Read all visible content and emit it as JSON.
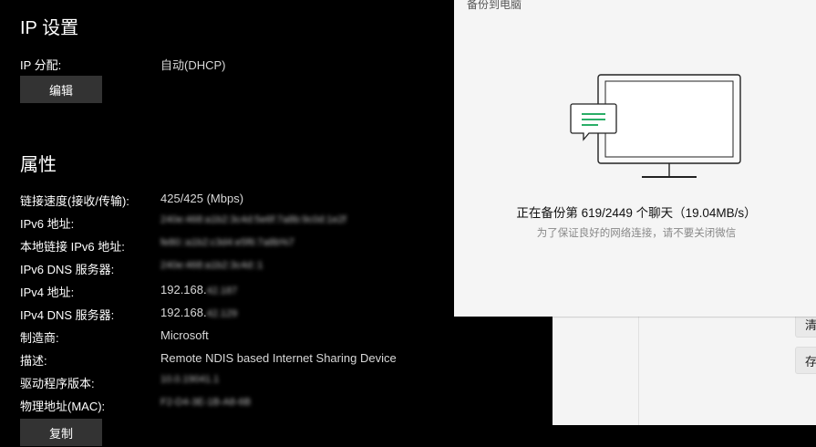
{
  "ip_settings": {
    "title": "IP 设置",
    "assign_label": "IP 分配:",
    "assign_value": "自动(DHCP)",
    "edit_button": "编辑"
  },
  "properties": {
    "title": "属性",
    "rows": [
      {
        "label": "链接速度(接收/传输):",
        "value": "425/425 (Mbps)"
      },
      {
        "label": "IPv6 地址:",
        "value": "240e:468:a1b2:3c4d:5e6f:7a8b:9c0d:1e2f"
      },
      {
        "label": "本地链接 IPv6 地址:",
        "value": "fe80::a1b2:c3d4:e5f6:7a8b%7"
      },
      {
        "label": "IPv6 DNS 服务器:",
        "value": "240e:468:a1b2:3c4d::1"
      },
      {
        "label": "IPv4 地址:",
        "value": "192.168.",
        "hidden": "42.187"
      },
      {
        "label": "IPv4 DNS 服务器:",
        "value": "192.168.",
        "hidden": "42.129"
      },
      {
        "label": "制造商:",
        "value": "Microsoft"
      },
      {
        "label": "描述:",
        "value": "Remote NDIS based Internet Sharing Device"
      },
      {
        "label": "驱动程序版本:",
        "value": "10.0.19041.1"
      },
      {
        "label": "物理地址(MAC):",
        "value": "F2-D4-3E-1B-A8-6B"
      }
    ],
    "copy_button": "复制"
  },
  "wechat_backup": {
    "title": "备份到电脑",
    "status": "正在备份第 619/2449 个聊天（19.04MB/s）",
    "hint": "为了保证良好的网络连接，请不要关闭微信",
    "accent_color": "#2aae67",
    "icon": "computer-with-chat-bubble-illustration"
  },
  "background_window": {
    "button1": "清",
    "button2": "存"
  }
}
